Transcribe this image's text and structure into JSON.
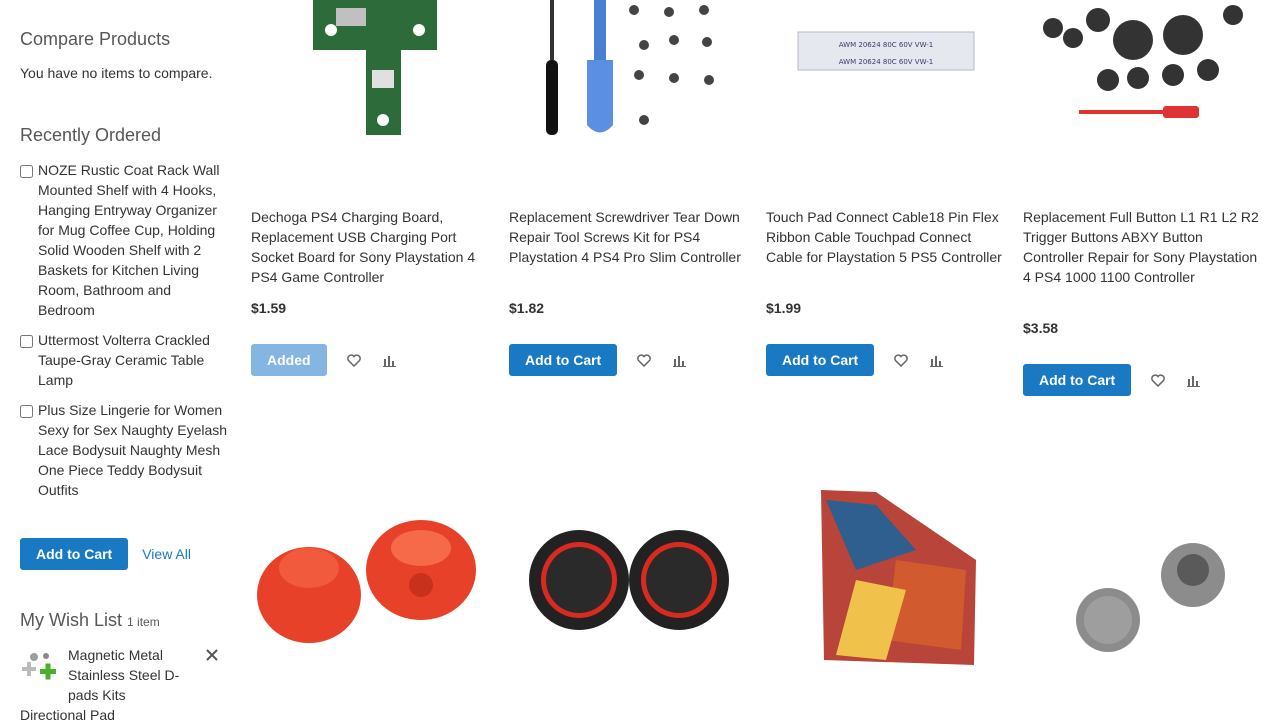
{
  "sidebar": {
    "compare": {
      "title": "Compare Products",
      "empty_text": "You have no items to compare."
    },
    "recently_ordered": {
      "title": "Recently Ordered",
      "items": [
        {
          "label": "NOZE Rustic Coat Rack Wall Mounted Shelf with 4 Hooks, Hanging Entryway Organizer for Mug Coffee Cup, Holding Solid Wooden Shelf with 2 Baskets for Kitchen Living Room, Bathroom and Bedroom"
        },
        {
          "label": "Uttermost Volterra Crackled Taupe-Gray Ceramic Table Lamp"
        },
        {
          "label": "Plus Size Lingerie for Women Sexy for Sex Naughty Eyelash Lace Bodysuit Naughty Mesh One Piece Teddy Bodysuit Outfits"
        }
      ],
      "add_to_cart_label": "Add to Cart",
      "view_all_label": "View All"
    },
    "wishlist": {
      "title": "My Wish List",
      "count": "1 item",
      "item_name": "Magnetic Metal Stainless Steel D-pads Kits",
      "item_name_tail": "Directional Pad",
      "thumb_icon": "dpad-kit-icon",
      "remove_icon": "close-icon"
    }
  },
  "products": [
    {
      "name": "Dechoga PS4 Charging Board, Replacement USB Charging Port Socket Board for Sony Playstation 4 PS4 Game Controller",
      "price": "$1.59",
      "button_label": "Added",
      "image_icon": "charging-board-image"
    },
    {
      "name": "Replacement Screwdriver Tear Down Repair Tool Screws Kit for PS4 Playstation 4 PS4 Pro Slim Controller",
      "price": "$1.82",
      "button_label": "Add to Cart",
      "image_icon": "screwdriver-kit-image"
    },
    {
      "name": "Touch Pad Connect Cable18 Pin Flex Ribbon Cable Touchpad Connect Cable for Playstation 5 PS5 Controller",
      "price": "$1.99",
      "button_label": "Add to Cart",
      "image_icon": "ribbon-cable-image",
      "cable_text": "AWM 20624 80C 60V VW-1"
    },
    {
      "name": "Replacement Full Button L1 R1 L2 R2 Trigger Buttons ABXY Button Controller Repair for Sony Playstation 4 PS4 1000 1100 Controller",
      "price": "$3.58",
      "button_label": "Add to Cart",
      "image_icon": "button-set-image"
    },
    {
      "image_icon": "red-thumbsticks-image"
    },
    {
      "image_icon": "black-red-thumb-grips-image"
    },
    {
      "image_icon": "console-skin-image"
    },
    {
      "image_icon": "grey-thumb-caps-image"
    }
  ],
  "icons": {
    "wishlist": "heart-icon",
    "compare": "bar-chart-icon"
  },
  "colors": {
    "primary": "#1979c3",
    "added": "#85b5e1",
    "link": "#1979c3"
  }
}
